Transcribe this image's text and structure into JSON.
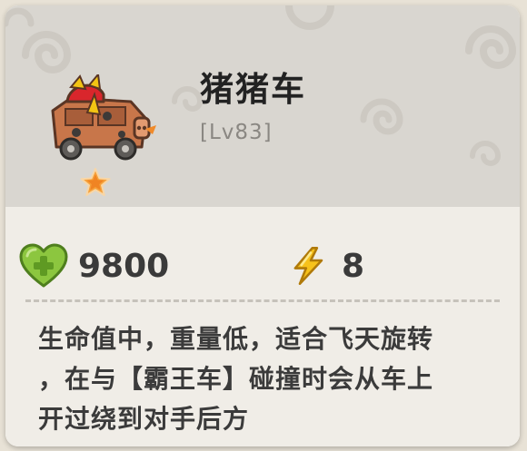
{
  "card": {
    "title": "猪猪车",
    "level": "[Lv83]",
    "car_icon": "pig-car-icon",
    "rarity_icon": "orange-star-icon"
  },
  "stats": {
    "health": {
      "icon": "green-heart-plus-icon",
      "value": "9800"
    },
    "energy": {
      "icon": "lightning-bolt-icon",
      "value": "8"
    }
  },
  "description": "生命值中，重量低，适合飞天旋转\n，在与【霸王车】碰撞时会从车上\n开过绕到对手后方",
  "colors": {
    "header_bg": "#d9d6d0",
    "body_bg": "#f0ede7",
    "title": "#222222",
    "level": "#8a8782",
    "heart_green": "#8cc63f",
    "bolt_yellow": "#f7c21b",
    "star_orange": "#f6a13a"
  }
}
